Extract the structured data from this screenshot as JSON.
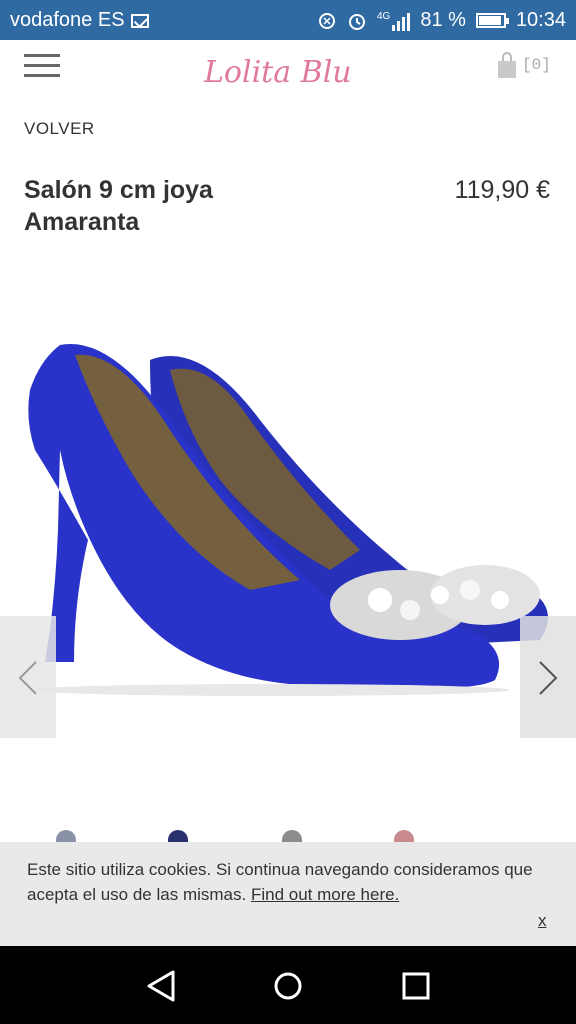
{
  "status_bar": {
    "carrier": "vodafone ES",
    "network": "4G",
    "battery": "81 %",
    "time": "10:34"
  },
  "header": {
    "logo_text": "Lolita Blu",
    "cart_count": "[0]"
  },
  "page": {
    "back_label": "VOLVER",
    "product_title": "Salón 9 cm joya Amaranta",
    "price": "119,90 €"
  },
  "cookie_banner": {
    "text": "Este sitio utiliza cookies. Si continua navegando consideramos que acepta el uso de las mismas.",
    "link": "Find out more here.",
    "close": "x"
  },
  "colors": {
    "status_bar": "#2f6aa3",
    "logo_pink": "#e07a9a",
    "shoe_blue": "#2a33c9"
  },
  "icons": [
    "menu-icon",
    "cart-icon",
    "prev-arrow-icon",
    "next-arrow-icon",
    "back-icon",
    "home-icon",
    "recents-icon"
  ]
}
